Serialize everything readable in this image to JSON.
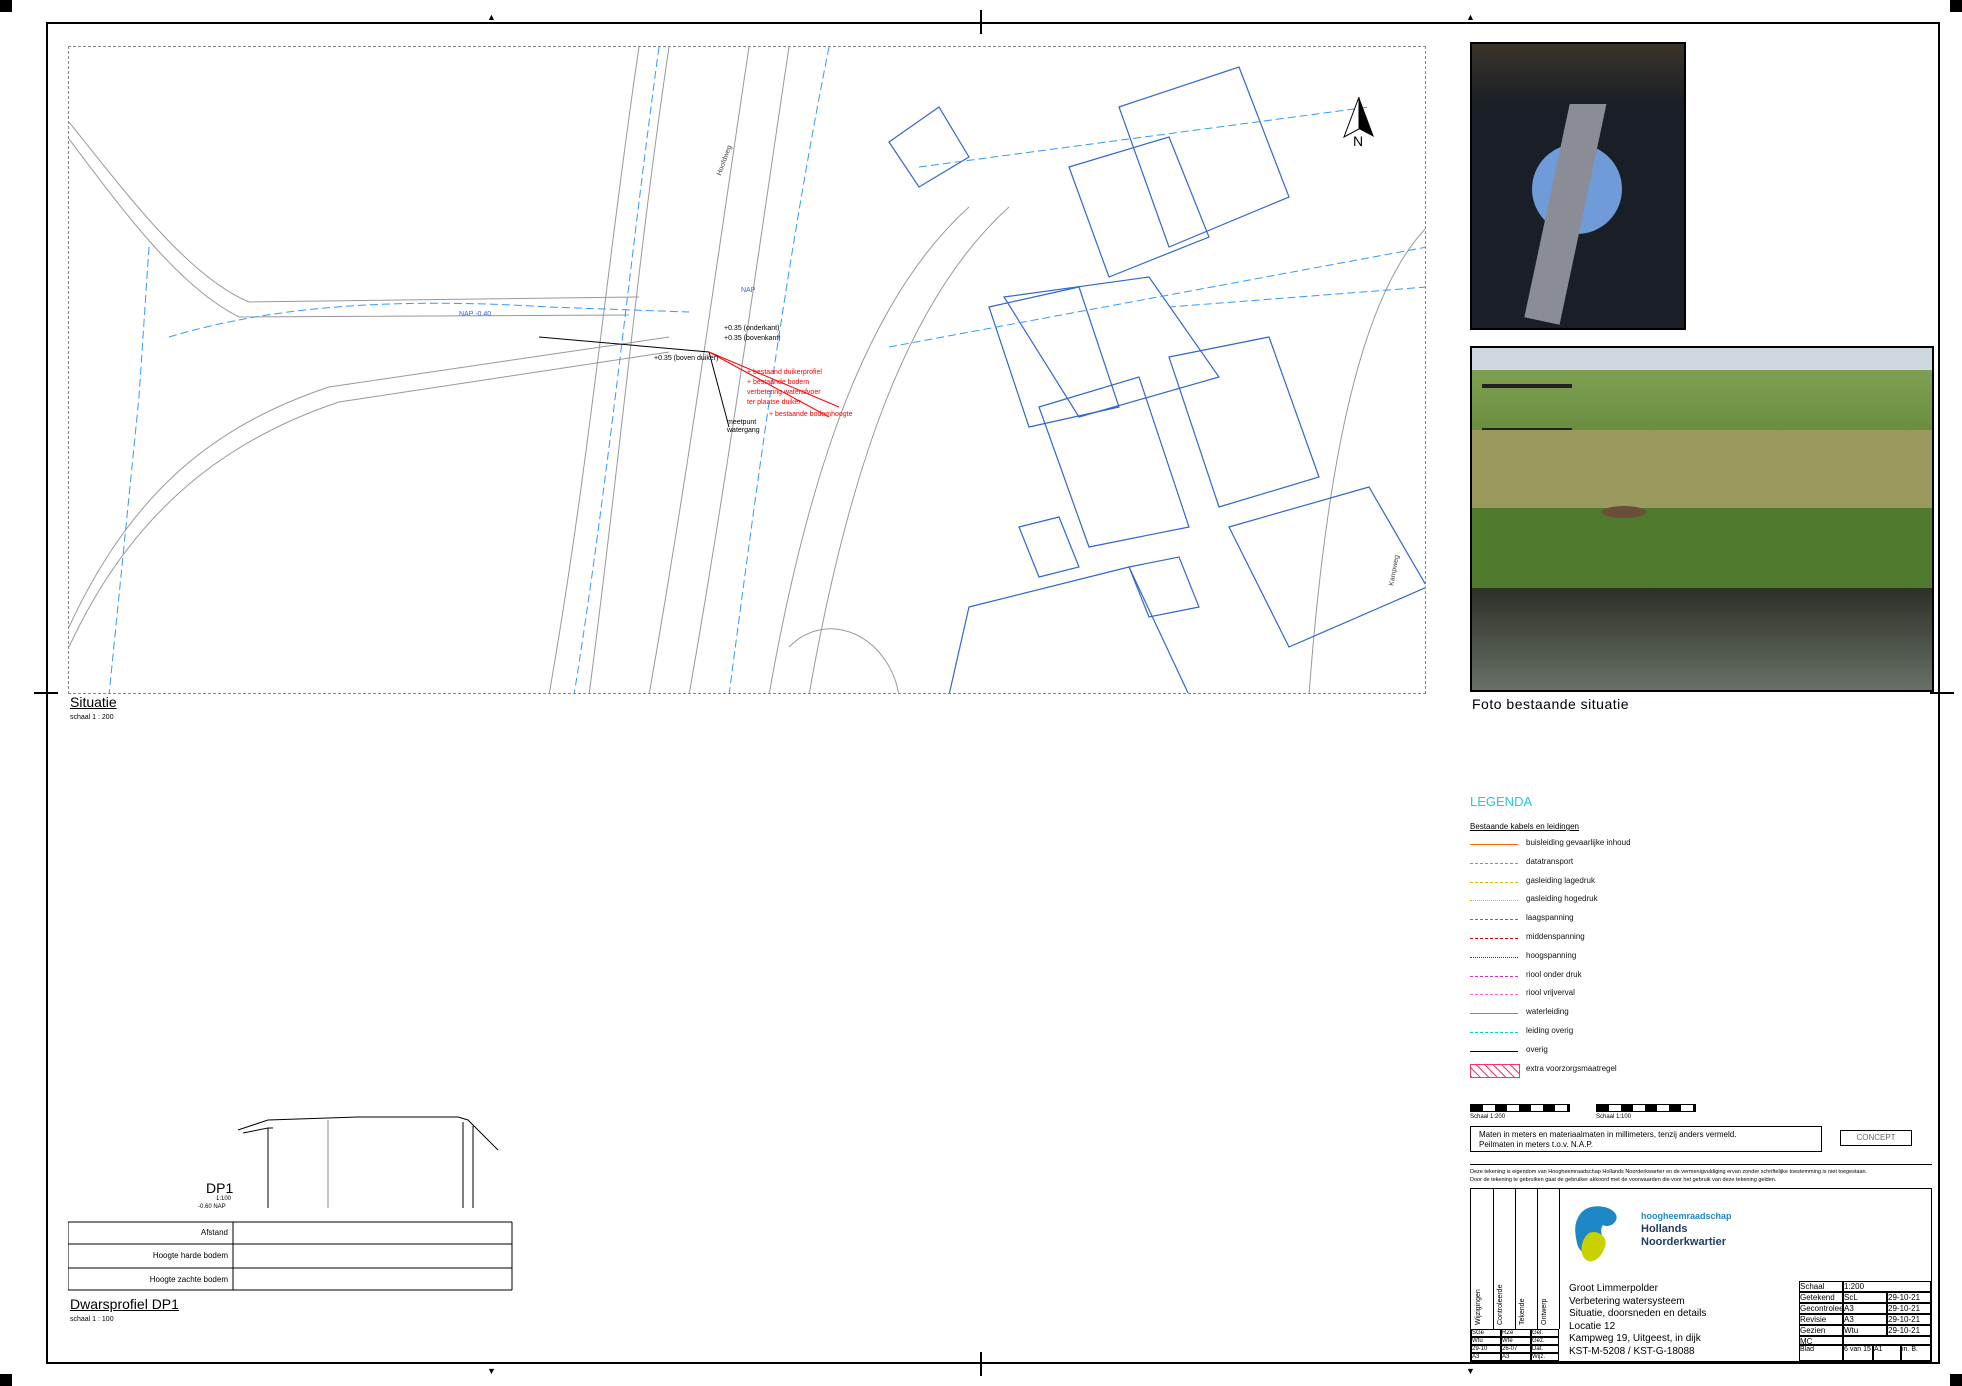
{
  "situatie": {
    "title": "Situatie",
    "scale": "schaal 1 : 200",
    "map_labels": {
      "north": "N",
      "road_name": "Hoofdweg",
      "street_right": "Kampweg",
      "marker_left": "NAP -0.40",
      "marker_mid": "NAP",
      "annot_level_1": "+0.35 (onderkant)",
      "annot_level_2": "+0.35 (bovenkant)",
      "annot_level_3": "+0.35 (boven duiker)",
      "annot_red_1": "+ bestaand duikerprofiel",
      "annot_red_2": "+ bestaande bodem",
      "annot_red_3": "verbetering waterafvoer",
      "annot_red_4": "ter plaatse duiker",
      "annot_red_5": "+ bestaande bodemhoogte",
      "annot_black_1": "meetpunt",
      "annot_black_2": "watergang"
    }
  },
  "photos": {
    "title": "Foto bestaande situatie"
  },
  "legend": {
    "title": "LEGENDA",
    "subtitle": "Bestaande kabels en leidingen",
    "items": [
      {
        "label": "buisleiding gevaarlijke inhoud",
        "color": "#ff6600",
        "dash": "solid"
      },
      {
        "label": "datatransport",
        "color": "#33cc33",
        "dash": "dashed"
      },
      {
        "label": "gasleiding lagedruk",
        "color": "#e6b800",
        "dash": "dashed"
      },
      {
        "label": "gasleiding hogedruk",
        "color": "#e6b800",
        "dash": "dotted"
      },
      {
        "label": "laagspanning",
        "color": "#ff3333",
        "dash": "dashed"
      },
      {
        "label": "middenspanning",
        "color": "#cc0000",
        "dash": "dashed"
      },
      {
        "label": "hoogspanning",
        "color": "#cc0000",
        "dash": "dotted"
      },
      {
        "label": "riool onder druk",
        "color": "#cc33cc",
        "dash": "dashed"
      },
      {
        "label": "riool vrijverval",
        "color": "#ff66cc",
        "dash": "dashed"
      },
      {
        "label": "waterleiding",
        "color": "#3399ff",
        "dash": "solid"
      },
      {
        "label": "leiding overig",
        "color": "#00cccc",
        "dash": "dashed"
      },
      {
        "label": "overig",
        "color": "#000000",
        "dash": "solid"
      },
      {
        "label": "extra voorzorgsmaatregel",
        "color": "#ff3366",
        "dash": "hatch"
      }
    ]
  },
  "scalebars": {
    "left_label": "Schaal 1:200",
    "right_label": "Schaal 1:100"
  },
  "notes": {
    "line1": "Maten in meters en materiaalmaten in millimeters, tenzij anders vermeld.",
    "line2": "Peilmaten in meters t.o.v. N.A.P.",
    "stamp": "CONCEPT"
  },
  "disclaimer": {
    "line1": "Deze tekening is eigendom van Hoogheemraadschap Hollands Noorderkwartier en de vermenigvuldiging ervan zonder schriftelijke toestemming is niet toegestaan.",
    "line2": "Door de tekening te gebruiken gaat de gebruiker akkoord met de voorwaarden die voor het gebruik van deze tekening gelden."
  },
  "titleblock": {
    "side_labels": [
      "Wijzigingen",
      "Controleerde",
      "Tekende",
      "Ontwerp"
    ],
    "org_line1": "hoogheemraadschap",
    "org_line2": "Hollands",
    "org_line3": "Noorderkwartier",
    "project_lines": [
      "Groot Limmerpolder",
      "Verbetering watersysteem",
      "Situatie, doorsneden en details",
      "Locatie 12",
      "Kampweg 19, Uitgeest, in dijk",
      "KST-M-5208 / KST-G-18088"
    ],
    "meta": [
      {
        "k": "Getekend",
        "v": "ScL",
        "d": "29-10-21"
      },
      {
        "k": "Gecontroleerd",
        "v": "A3",
        "d": "29-10-21"
      },
      {
        "k": "Revisie",
        "v": "A3",
        "d": "29-10-21"
      },
      {
        "k": "Gezien",
        "v": "Wtu",
        "d": "29-10-21"
      },
      {
        "k": "MC",
        "v": "",
        "d": ""
      }
    ],
    "scale_box": {
      "k": "Schaal",
      "v": "1:200"
    },
    "sheet": {
      "k": "Blad",
      "v": "6 van 15"
    },
    "format": {
      "k": "Form.",
      "v": "A1"
    },
    "regnr": {
      "k": "Reg.nr.",
      "v": "in. B."
    },
    "sig_row1": [
      "SGe",
      "RZe",
      "Gel."
    ],
    "sig_row2": [
      "Wtu",
      "Wte",
      "Gez."
    ],
    "sig_row3": [
      "29-10",
      "26-07",
      "Dat."
    ],
    "sig_row4": [
      "A3",
      "A3",
      "Wijz."
    ]
  },
  "dwarsprofiel": {
    "title": "Dwarsprofiel DP1",
    "scale": "schaal 1 : 100",
    "tag": "DP1",
    "tag_sub1": "1:100",
    "tag_sub2": "-0.60 NAP",
    "rows": [
      "Afstand",
      "Hoogte harde bodem",
      "Hoogte zachte bodem"
    ]
  }
}
